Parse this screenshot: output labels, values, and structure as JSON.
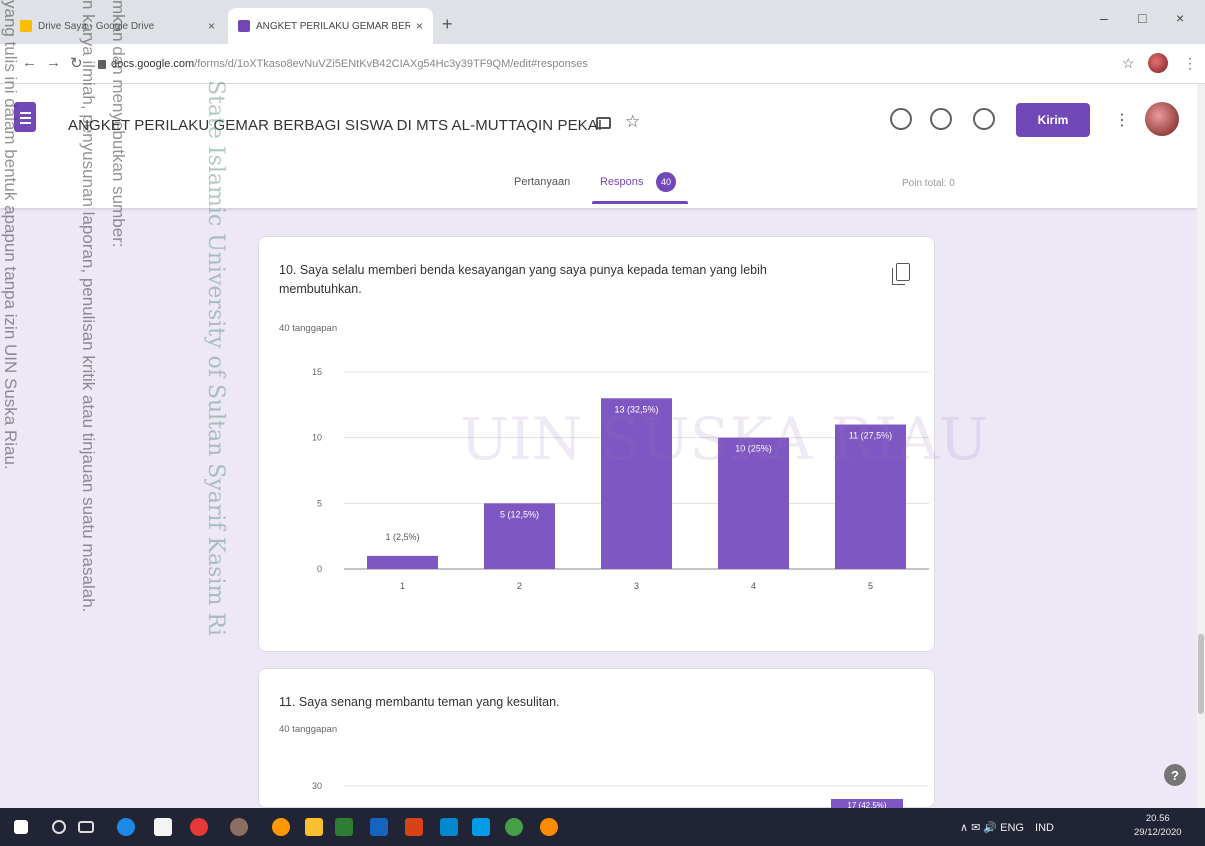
{
  "browser": {
    "tabs": [
      {
        "title": "Drive Saya - Google Drive",
        "favicon_color": "#fbbc04"
      },
      {
        "title": "ANGKET PERILAKU GEMAR BERBAGI SISWA",
        "favicon_color": "#7248b9"
      }
    ],
    "new_tab": "+",
    "url_host": "docs.google.com",
    "url_path": "/forms/d/1oXTkaso8evNuVZi5ENtKvB42CIAXg54Hc3y39TF9QM/edit#responses",
    "window_controls": [
      "–",
      "□",
      "×"
    ]
  },
  "form": {
    "title": "ANGKET PERILAKU GEMAR BERBAGI SISWA DI MTS AL-MUTTAQIN PEKAI",
    "send_label": "Kirim",
    "tab_questions": "Pertanyaan",
    "tab_responses": "Respons",
    "response_count": "40",
    "total_points": "Poin total: 0"
  },
  "questions": [
    {
      "title": "10. Saya selalu memberi benda kesayangan yang saya punya kepada teman yang lebih membutuhkan.",
      "response_summary": "40 tanggapan"
    },
    {
      "title": "11. Saya senang membantu teman yang kesulitan.",
      "response_summary": "40 tanggapan"
    }
  ],
  "chart_data": [
    {
      "type": "bar",
      "categories": [
        "1",
        "2",
        "3",
        "4",
        "5"
      ],
      "values": [
        1,
        5,
        13,
        10,
        11
      ],
      "data_labels": [
        "1 (2,5%)",
        "5 (12,5%)",
        "13 (32,5%)",
        "10 (25%)",
        "11 (27,5%)"
      ],
      "yticks": [
        "0",
        "5",
        "10",
        "15"
      ],
      "ylim": [
        0,
        15
      ],
      "grid": true,
      "bar_color": "#7e57c2"
    },
    {
      "type": "bar",
      "yticks": [
        "30"
      ],
      "partial_label": "17 (42,5%)",
      "ylim": [
        0,
        30
      ]
    }
  ],
  "taskbar": {
    "tray_text": "∧ ✉ 🔊 ENG",
    "tray_lang": "IND",
    "time": "20.56",
    "date": "29/12/2020"
  },
  "watermarks": {
    "lines": [
      "yang tulis ini dalam bentuk apapun tanpa izin UIN Suska Riau.",
      "n karya ilmiah, penyusunan laporan, penulisan kritik atau tinjauan suatu masalah.",
      "mkan dan menyebutkan sumber:"
    ],
    "university": "State Islamic University of Sultan Syarif Kasim Ri",
    "logo_text": "UIN SUSKA RIAU"
  }
}
